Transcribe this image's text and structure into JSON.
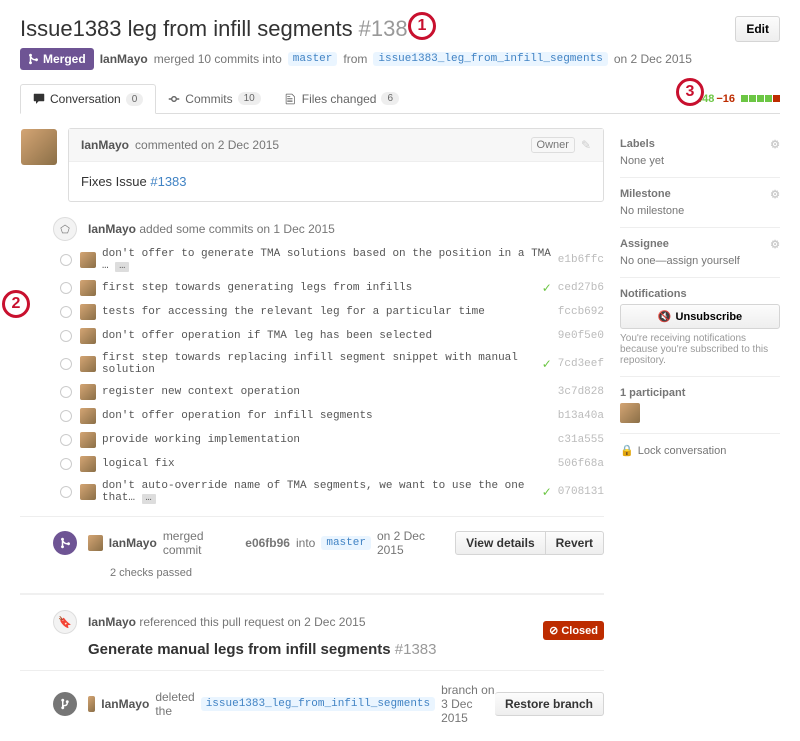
{
  "title": "Issue1383 leg from infill segments",
  "issue_number": "#1387",
  "edit": "Edit",
  "merged_badge": "Merged",
  "author": "IanMayo",
  "merged_line_mid": "merged 10 commits into",
  "branch_base": "master",
  "from_word": "from",
  "branch_head": "issue1383_leg_from_infill_segments",
  "merged_date": "on 2 Dec 2015",
  "tabs": {
    "conversation": "Conversation",
    "conversation_count": "0",
    "commits": "Commits",
    "commits_count": "10",
    "files": "Files changed",
    "files_count": "6"
  },
  "diff_added": "+448",
  "diff_removed": "−16",
  "comment": {
    "author": "IanMayo",
    "date": "commented on 2 Dec 2015",
    "owner": "Owner",
    "body_prefix": "Fixes Issue ",
    "body_link": "#1383"
  },
  "commits_header": {
    "user": "IanMayo",
    "text": "added some commits on 1 Dec 2015"
  },
  "commits": [
    {
      "msg": "don't offer to generate TMA solutions based on the position in a TMA …",
      "hash": "e1b6ffc",
      "ellipsis": true,
      "check": false
    },
    {
      "msg": "first step towards generating legs from infills",
      "hash": "ced27b6",
      "check": true
    },
    {
      "msg": "tests for accessing the relevant leg for a particular time",
      "hash": "fccb692",
      "check": false
    },
    {
      "msg": "don't offer operation if TMA leg has been selected",
      "hash": "9e0f5e0",
      "check": false
    },
    {
      "msg": "first step towards replacing infill segment snippet with manual solution",
      "hash": "7cd3eef",
      "check": true
    },
    {
      "msg": "register new context operation",
      "hash": "3c7d828",
      "check": false
    },
    {
      "msg": "don't offer operation for infill segments",
      "hash": "b13a40a",
      "check": false
    },
    {
      "msg": "provide working implementation",
      "hash": "c31a555",
      "check": false
    },
    {
      "msg": "logical fix",
      "hash": "506f68a",
      "check": false
    },
    {
      "msg": "don't auto-override name of TMA segments, we want to use the one that…",
      "hash": "0708131",
      "ellipsis": true,
      "check": true
    }
  ],
  "merge_event": {
    "user": "IanMayo",
    "text_pre": "merged commit",
    "commit": "e06fb96",
    "into": "into",
    "branch": "master",
    "date": "on 2 Dec 2015",
    "view": "View details",
    "revert": "Revert",
    "checks": "2 checks passed"
  },
  "ref_event": {
    "user": "IanMayo",
    "text": "referenced this pull request on 2 Dec 2015",
    "title": "Generate manual legs from infill segments",
    "num": "#1383",
    "closed": "Closed"
  },
  "delete_event": {
    "user": "IanMayo",
    "text_pre": "deleted the",
    "branch": "issue1383_leg_from_infill_segments",
    "text_post": "branch on 3 Dec 2015",
    "restore": "Restore branch"
  },
  "sidebar": {
    "labels": "Labels",
    "labels_none": "None yet",
    "milestone": "Milestone",
    "milestone_none": "No milestone",
    "assignee": "Assignee",
    "assignee_none": "No one—assign yourself",
    "notifications": "Notifications",
    "unsubscribe": "Unsubscribe",
    "notif_note": "You're receiving notifications because you're subscribed to this repository.",
    "participants": "1 participant",
    "lock": "Lock conversation"
  },
  "annotations": {
    "a1": "1",
    "a2": "2",
    "a3": "3"
  }
}
